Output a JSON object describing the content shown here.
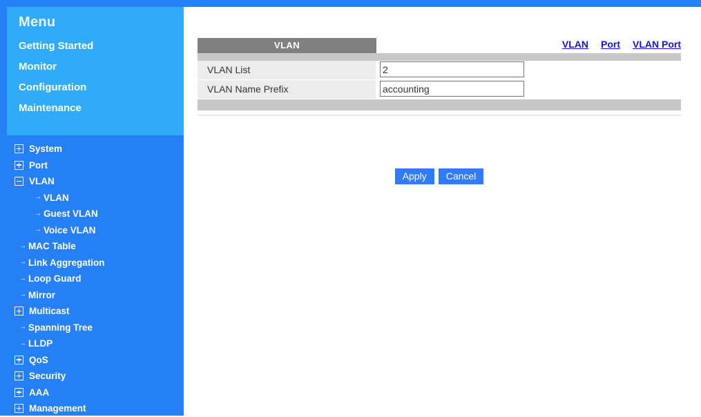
{
  "theme": {
    "accent_blue": "#2680f5",
    "panel_cyan": "#2fabf7",
    "tab_gray": "#808080",
    "strip_gray": "#c8c8c8",
    "row_gray": "#ececec",
    "link_blue": "#1414e6",
    "button_blue": "#2f7cf6"
  },
  "sidebar": {
    "title": "Menu",
    "menu_links": [
      {
        "label": "Getting Started"
      },
      {
        "label": "Monitor"
      },
      {
        "label": "Configuration"
      },
      {
        "label": "Maintenance"
      }
    ],
    "tree": [
      {
        "label": "System",
        "icon": "plus-box-icon",
        "level": 0
      },
      {
        "label": "Port",
        "icon": "plus-box-icon",
        "level": 0
      },
      {
        "label": "VLAN",
        "icon": "minus-box-icon",
        "level": 0
      },
      {
        "label": "VLAN",
        "icon": "arrow-icon",
        "level": 2
      },
      {
        "label": "Guest VLAN",
        "icon": "arrow-icon",
        "level": 2
      },
      {
        "label": "Voice VLAN",
        "icon": "arrow-icon",
        "level": 2
      },
      {
        "label": "MAC Table",
        "icon": "arrow-icon",
        "level": 1
      },
      {
        "label": "Link Aggregation",
        "icon": "arrow-icon",
        "level": 1
      },
      {
        "label": "Loop Guard",
        "icon": "arrow-icon",
        "level": 1
      },
      {
        "label": "Mirror",
        "icon": "arrow-icon",
        "level": 1
      },
      {
        "label": "Multicast",
        "icon": "plus-box-icon",
        "level": 0
      },
      {
        "label": "Spanning Tree",
        "icon": "arrow-icon",
        "level": 1
      },
      {
        "label": "LLDP",
        "icon": "arrow-icon",
        "level": 1
      },
      {
        "label": "QoS",
        "icon": "plus-box-icon",
        "level": 0
      },
      {
        "label": "Security",
        "icon": "plus-box-icon",
        "level": 0
      },
      {
        "label": "AAA",
        "icon": "plus-box-icon",
        "level": 0
      },
      {
        "label": "Management",
        "icon": "plus-box-icon",
        "level": 0
      }
    ]
  },
  "main": {
    "tab_label": "VLAN",
    "nav_links": [
      {
        "label": "VLAN"
      },
      {
        "label": "Port"
      },
      {
        "label": "VLAN Port"
      }
    ],
    "form_rows": [
      {
        "label": "VLAN List",
        "value": "2",
        "placeholder": ""
      },
      {
        "label": "VLAN Name Prefix",
        "value": "accounting",
        "placeholder": ""
      }
    ],
    "buttons": {
      "apply_label": "Apply",
      "cancel_label": "Cancel"
    }
  }
}
